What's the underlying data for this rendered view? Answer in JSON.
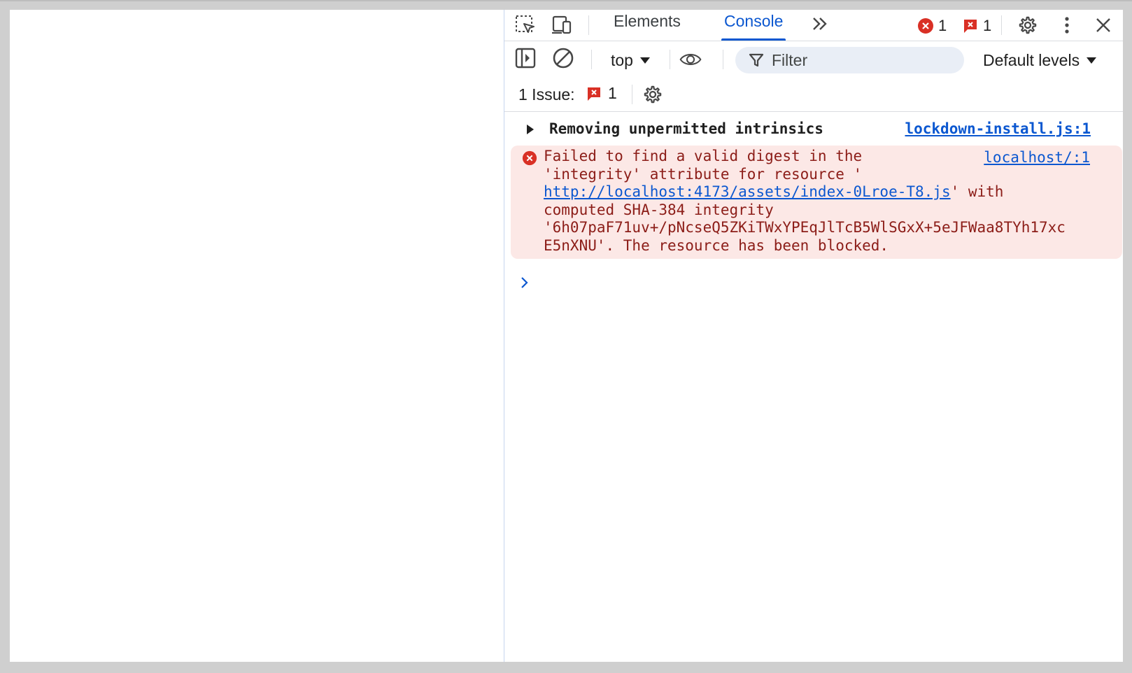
{
  "tabs": [
    {
      "label": "Elements",
      "active": false
    },
    {
      "label": "Console",
      "active": true
    }
  ],
  "counters": {
    "errors": "1",
    "issues": "1"
  },
  "toolbar": {
    "context": "top",
    "filter_placeholder": "Filter",
    "levels": "Default levels"
  },
  "issues_bar": {
    "label": "1 Issue:",
    "count": "1"
  },
  "messages": [
    {
      "level": "info",
      "text": "Removing unpermitted intrinsics",
      "source": "lockdown-install.js:1"
    },
    {
      "level": "error",
      "source": "localhost/:1",
      "line1": "Failed to find a valid digest in the",
      "line2": "'integrity' attribute for resource '",
      "link": "http://localhost:4173/assets/index-0Lroe-T8.js",
      "line3_suffix": "' with",
      "line4": "computed SHA-384 integrity",
      "line5": "'6h07paF71uv+/pNcseQ5ZKiTWxYPEqJlTcB5WlSGxX+5eJFWaa8TYh17xc",
      "line6": "E5nXNU'. The resource has been blocked."
    }
  ],
  "colors": {
    "accent": "#0b57d0",
    "error": "#d93025",
    "error_bg": "#fce8e6",
    "error_text": "#8c1d18"
  },
  "icons": [
    "inspect-element-icon",
    "device-toolbar-icon",
    "more-tabs-icon",
    "error-icon",
    "issue-flag-icon",
    "settings-icon",
    "kebab-menu-icon",
    "close-icon",
    "sidebar-toggle-icon",
    "clear-console-icon",
    "live-expression-eye-icon",
    "filter-funnel-icon",
    "prompt-chevron-icon"
  ]
}
